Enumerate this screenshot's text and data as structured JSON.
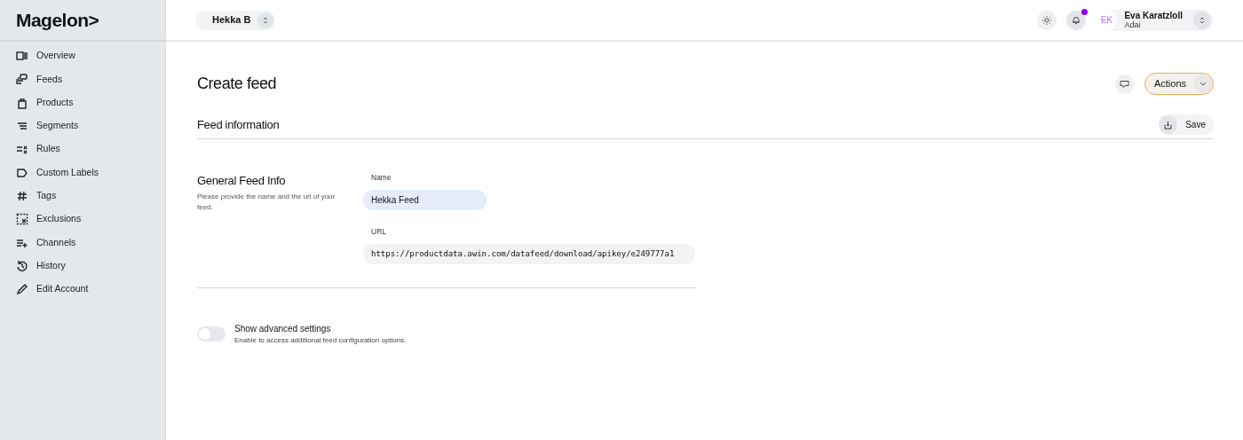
{
  "sidebar": {
    "logo": "Magelon>",
    "items": [
      {
        "label": "Overview"
      },
      {
        "label": "Feeds"
      },
      {
        "label": "Products"
      },
      {
        "label": "Segments"
      },
      {
        "label": "Rules"
      },
      {
        "label": "Custom Labels"
      },
      {
        "label": "Tags"
      },
      {
        "label": "Exclusions"
      },
      {
        "label": "Channels"
      },
      {
        "label": "History"
      },
      {
        "label": "Edit Account"
      }
    ]
  },
  "header": {
    "workspace": "Hekka B",
    "notification": true,
    "user": {
      "initials": "EK",
      "name": "Eva Karatzloll",
      "company": "Adai"
    }
  },
  "page": {
    "title": "Create feed",
    "actions_button": "Actions",
    "section_title": "Feed information",
    "save_button": "Save",
    "group": {
      "title": "General Feed Info",
      "description": "Please provide the name and the url of your feed.",
      "fields": [
        {
          "label": "Name",
          "value": "Hekka Feed",
          "focused": true,
          "mono": false
        },
        {
          "label": "URL",
          "value": "https://productdata.awin.com/datafeed/download/apikey/e249777a1",
          "focused": false,
          "mono": true
        }
      ]
    },
    "advanced": {
      "label": "Show advanced settings",
      "description": "Enable to access additional feed configuration options.",
      "on": false
    }
  }
}
